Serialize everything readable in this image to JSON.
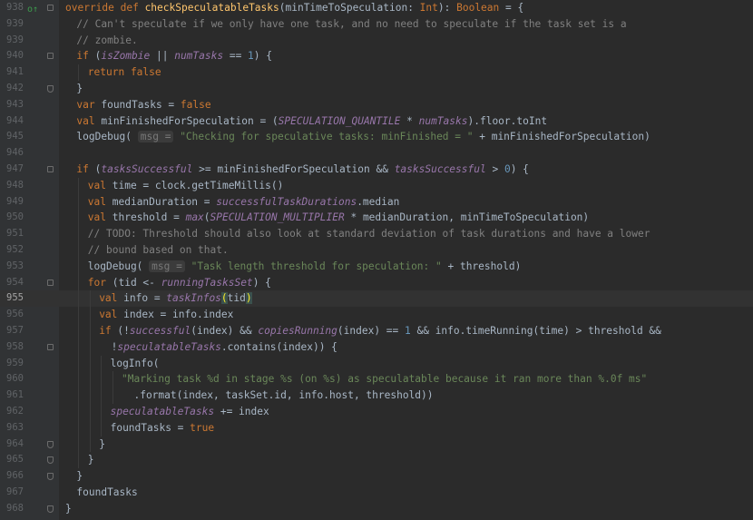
{
  "editor": {
    "current_line": "955",
    "lines": [
      {
        "n": "938",
        "icon": "override-icon",
        "fold": "start",
        "indent": 0,
        "tokens": [
          [
            "kw",
            "override def "
          ],
          [
            "fn",
            "checkSpeculatableTasks"
          ],
          [
            "p",
            "(minTimeToSpeculation: "
          ],
          [
            "kw",
            "Int"
          ],
          [
            "p",
            "): "
          ],
          [
            "kw",
            "Boolean"
          ],
          [
            "p",
            " = {"
          ]
        ]
      },
      {
        "n": "939",
        "indent": 1,
        "tokens": [
          [
            "cm",
            "// Can't speculate if we only have one task, and no need to speculate if the task set is a"
          ]
        ]
      },
      {
        "n": "939",
        "indent": 1,
        "tokens": [
          [
            "cm",
            "// zombie."
          ]
        ]
      },
      {
        "n": "940",
        "fold": "start",
        "indent": 1,
        "tokens": [
          [
            "kw",
            "if "
          ],
          [
            "p",
            "("
          ],
          [
            "it",
            "isZombie"
          ],
          [
            "p",
            " || "
          ],
          [
            "it",
            "numTasks"
          ],
          [
            "p",
            " == "
          ],
          [
            "num",
            "1"
          ],
          [
            "p",
            ") {"
          ]
        ]
      },
      {
        "n": "941",
        "indent": 2,
        "tokens": [
          [
            "kw",
            "return false"
          ]
        ]
      },
      {
        "n": "942",
        "fold": "end",
        "indent": 1,
        "tokens": [
          [
            "p",
            "}"
          ]
        ]
      },
      {
        "n": "943",
        "indent": 1,
        "tokens": [
          [
            "kw",
            "var "
          ],
          [
            "p",
            "foundTasks = "
          ],
          [
            "kw",
            "false"
          ]
        ]
      },
      {
        "n": "944",
        "indent": 1,
        "tokens": [
          [
            "kw",
            "val "
          ],
          [
            "p",
            "minFinishedForSpeculation = ("
          ],
          [
            "stat",
            "SPECULATION_QUANTILE"
          ],
          [
            "p",
            " * "
          ],
          [
            "it",
            "numTasks"
          ],
          [
            "p",
            ").floor.toInt"
          ]
        ]
      },
      {
        "n": "945",
        "indent": 1,
        "tokens": [
          [
            "p",
            "logDebug( "
          ],
          [
            "hint",
            "msg ="
          ],
          [
            "p",
            " "
          ],
          [
            "str",
            "\"Checking for speculative tasks: minFinished = \""
          ],
          [
            "p",
            " + minFinishedForSpeculation)"
          ]
        ]
      },
      {
        "n": "946",
        "indent": 1,
        "tokens": []
      },
      {
        "n": "947",
        "fold": "start",
        "indent": 1,
        "tokens": [
          [
            "kw",
            "if "
          ],
          [
            "p",
            "("
          ],
          [
            "it",
            "tasksSuccessful"
          ],
          [
            "p",
            " >= minFinishedForSpeculation && "
          ],
          [
            "it",
            "tasksSuccessful"
          ],
          [
            "p",
            " > "
          ],
          [
            "num",
            "0"
          ],
          [
            "p",
            ") {"
          ]
        ]
      },
      {
        "n": "948",
        "indent": 2,
        "tokens": [
          [
            "kw",
            "val "
          ],
          [
            "p",
            "time = clock.getTimeMillis()"
          ]
        ]
      },
      {
        "n": "949",
        "indent": 2,
        "tokens": [
          [
            "kw",
            "val "
          ],
          [
            "p",
            "medianDuration = "
          ],
          [
            "it",
            "successfulTaskDurations"
          ],
          [
            "p",
            ".median"
          ]
        ]
      },
      {
        "n": "950",
        "indent": 2,
        "tokens": [
          [
            "kw",
            "val "
          ],
          [
            "p",
            "threshold = "
          ],
          [
            "it",
            "max"
          ],
          [
            "p",
            "("
          ],
          [
            "stat",
            "SPECULATION_MULTIPLIER"
          ],
          [
            "p",
            " * medianDuration, minTimeToSpeculation)"
          ]
        ]
      },
      {
        "n": "951",
        "indent": 2,
        "tokens": [
          [
            "cm",
            "// TODO: Threshold should also look at standard deviation of task durations and have a lower"
          ]
        ]
      },
      {
        "n": "952",
        "indent": 2,
        "tokens": [
          [
            "cm",
            "// bound based on that."
          ]
        ]
      },
      {
        "n": "953",
        "indent": 2,
        "tokens": [
          [
            "p",
            "logDebug( "
          ],
          [
            "hint",
            "msg ="
          ],
          [
            "p",
            " "
          ],
          [
            "str",
            "\"Task length threshold for speculation: \""
          ],
          [
            "p",
            " + threshold)"
          ]
        ]
      },
      {
        "n": "954",
        "fold": "start",
        "indent": 2,
        "tokens": [
          [
            "kw",
            "for "
          ],
          [
            "p",
            "(tid <- "
          ],
          [
            "it",
            "runningTasksSet"
          ],
          [
            "p",
            ") {"
          ]
        ]
      },
      {
        "n": "955",
        "indent": 3,
        "tokens": [
          [
            "kw",
            "val "
          ],
          [
            "p",
            "info = "
          ],
          [
            "it",
            "taskInfos"
          ],
          [
            "brace",
            "("
          ],
          [
            "p",
            "tid"
          ],
          [
            "brace",
            ")"
          ]
        ]
      },
      {
        "n": "956",
        "indent": 3,
        "tokens": [
          [
            "kw",
            "val "
          ],
          [
            "p",
            "index = info.index"
          ]
        ]
      },
      {
        "n": "957",
        "indent": 3,
        "tokens": [
          [
            "kw",
            "if "
          ],
          [
            "p",
            "(!"
          ],
          [
            "it",
            "successful"
          ],
          [
            "p",
            "(index) && "
          ],
          [
            "it",
            "copiesRunning"
          ],
          [
            "p",
            "(index) == "
          ],
          [
            "num",
            "1"
          ],
          [
            "p",
            " && info.timeRunning(time) > threshold &&"
          ]
        ]
      },
      {
        "n": "958",
        "fold": "start",
        "indent": 3,
        "tokens": [
          [
            "p",
            "  !"
          ],
          [
            "it",
            "speculatableTasks"
          ],
          [
            "p",
            ".contains(index)) {"
          ]
        ]
      },
      {
        "n": "959",
        "indent": 4,
        "tokens": [
          [
            "p",
            "logInfo("
          ]
        ]
      },
      {
        "n": "960",
        "indent": 5,
        "tokens": [
          [
            "str",
            "\"Marking task %d in stage %s (on %s) as speculatable because it ran more than %.0f ms\""
          ]
        ]
      },
      {
        "n": "961",
        "indent": 5,
        "tokens": [
          [
            "p",
            "  .format(index, taskSet.id, info.host, threshold))"
          ]
        ]
      },
      {
        "n": "962",
        "indent": 4,
        "tokens": [
          [
            "it",
            "speculatableTasks"
          ],
          [
            "p",
            " += index"
          ]
        ]
      },
      {
        "n": "963",
        "indent": 4,
        "tokens": [
          [
            "p",
            "foundTasks = "
          ],
          [
            "kw",
            "true"
          ]
        ]
      },
      {
        "n": "964",
        "fold": "end",
        "indent": 3,
        "tokens": [
          [
            "p",
            "}"
          ]
        ]
      },
      {
        "n": "965",
        "fold": "end",
        "indent": 2,
        "tokens": [
          [
            "p",
            "}"
          ]
        ]
      },
      {
        "n": "966",
        "fold": "end",
        "indent": 1,
        "tokens": [
          [
            "p",
            "}"
          ]
        ]
      },
      {
        "n": "967",
        "indent": 1,
        "tokens": [
          [
            "p",
            "foundTasks"
          ]
        ]
      },
      {
        "n": "968",
        "fold": "end",
        "indent": 0,
        "tokens": [
          [
            "p",
            "}"
          ]
        ]
      }
    ]
  }
}
